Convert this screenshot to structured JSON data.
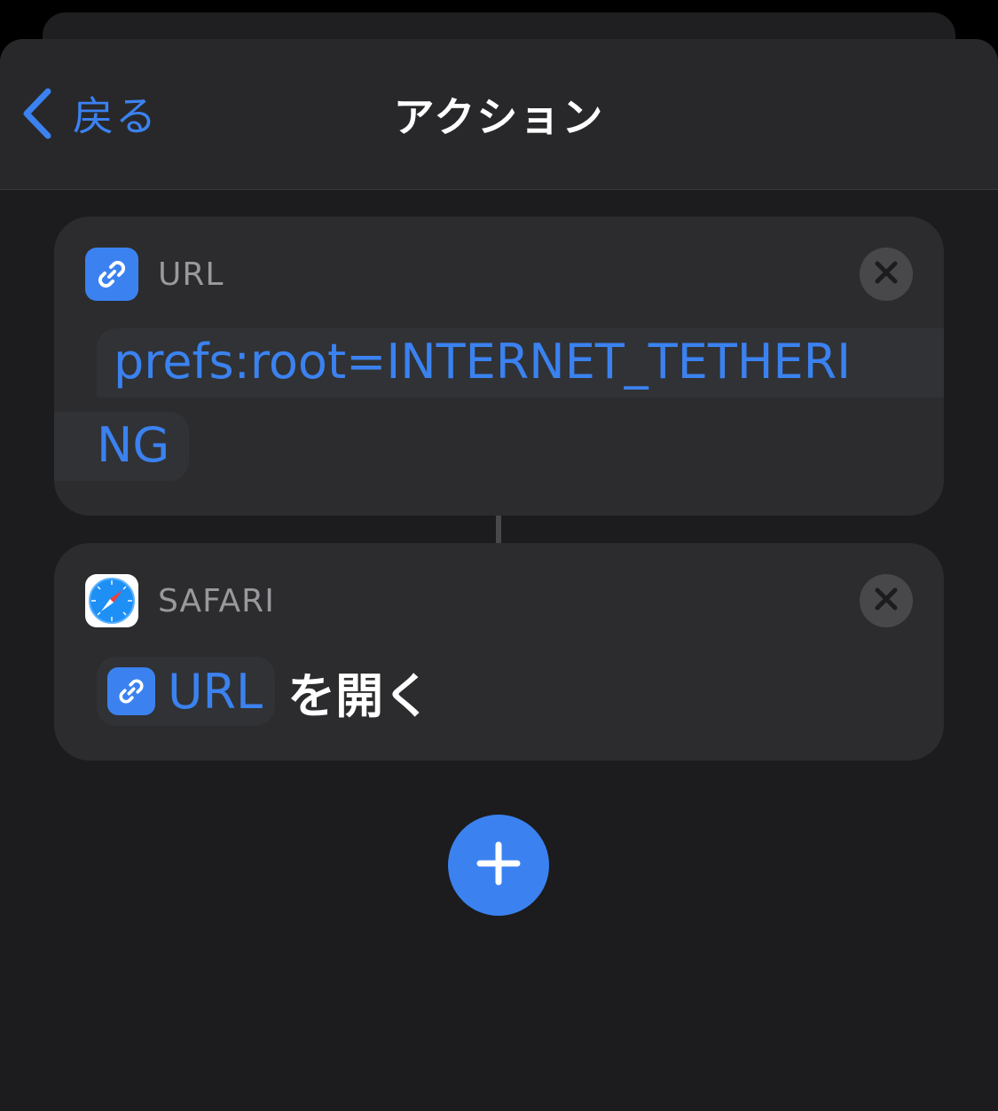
{
  "nav": {
    "back_label": "戻る",
    "title": "アクション"
  },
  "actions": [
    {
      "app": "URL",
      "icon": "link-icon",
      "value_line1": "prefs:root=INTERNET_TETHERI",
      "value_line2": "NG"
    },
    {
      "app": "SAFARI",
      "icon": "safari-compass-icon",
      "variable_label": "URL",
      "action_text": "を開く"
    }
  ],
  "colors": {
    "accent": "#3b82f0",
    "background": "#1c1c1e",
    "card": "#2c2c2e"
  }
}
